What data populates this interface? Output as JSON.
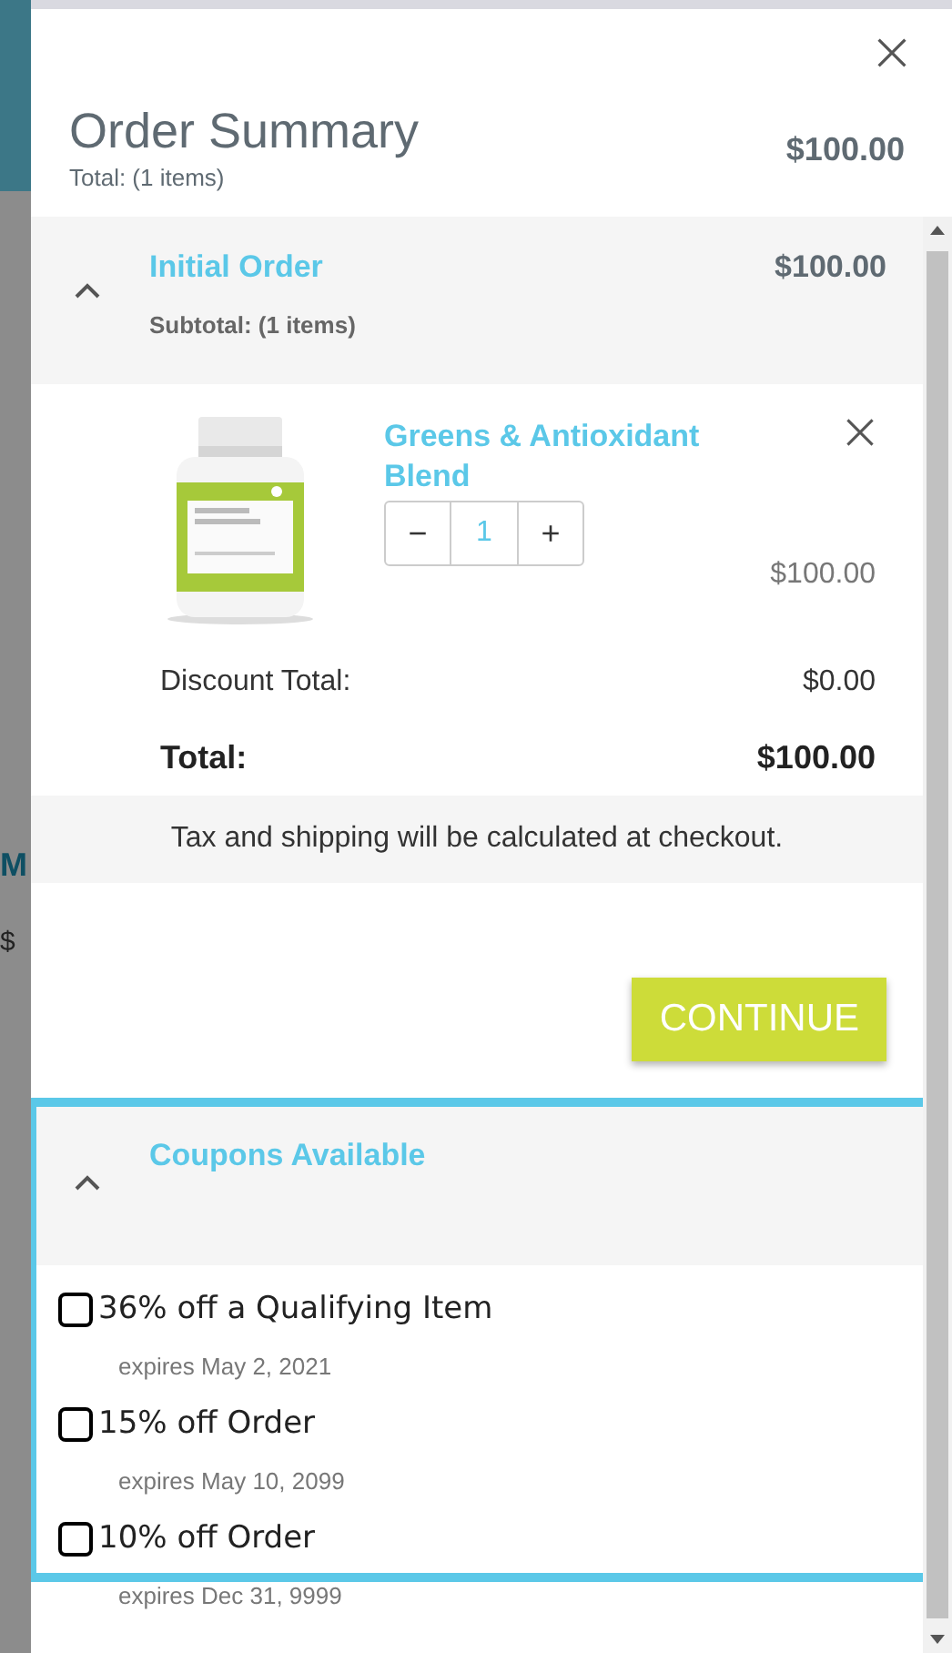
{
  "background_page": {
    "heading_fragment": "M",
    "price_fragment": "$"
  },
  "header": {
    "title": "Order Summary",
    "subtitle": "Total: (1 items)",
    "total": "$100.00"
  },
  "order_section": {
    "title": "Initial Order",
    "subtitle": "Subtotal: (1 items)",
    "amount": "$100.00",
    "expanded": true
  },
  "items": [
    {
      "name": "Greens & Antioxidant Blend",
      "minus": "−",
      "quantity": "1",
      "plus": "+",
      "price": "$100.00"
    }
  ],
  "summary_rows": [
    {
      "label": "Discount Total:",
      "value": "$0.00",
      "kind": "plain"
    },
    {
      "label": "Total:",
      "value": "$100.00",
      "kind": "bold"
    }
  ],
  "note": "Tax and shipping will be calculated at checkout.",
  "continue_button": "CONTINUE",
  "coupons_section": {
    "title": "Coupons Available",
    "expanded": true,
    "highlighted": true
  },
  "coupons": [
    {
      "title": "36% off a Qualifying Item",
      "expires": "expires May 2, 2021",
      "checked": false
    },
    {
      "title": "15% off Order",
      "expires": "expires May 10, 2099",
      "checked": false
    },
    {
      "title": "10% off Order",
      "expires": "expires Dec 31, 9999",
      "checked": false
    }
  ]
}
